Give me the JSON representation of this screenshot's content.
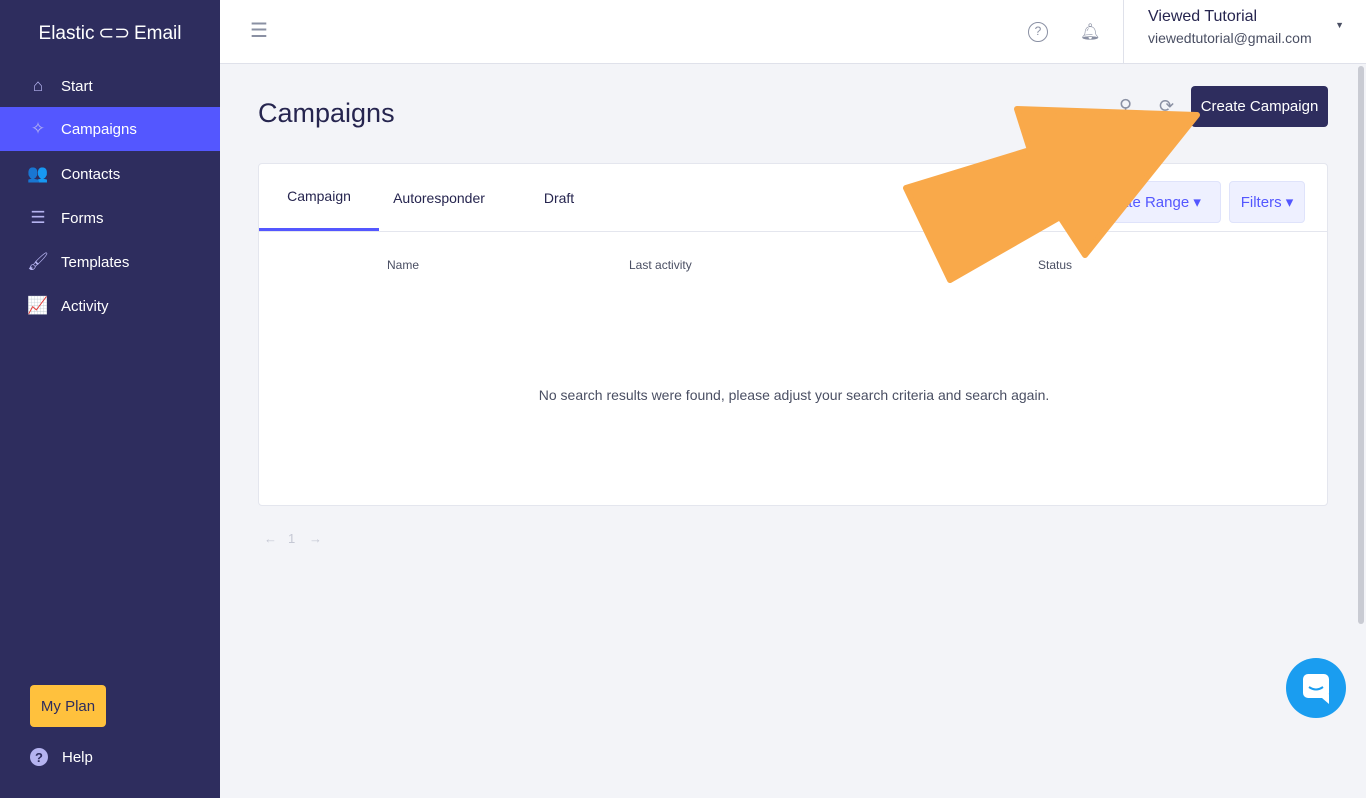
{
  "app": {
    "logo": "Elastic ⊂⊃ Email"
  },
  "sidebar": {
    "items": [
      {
        "label": "Start",
        "icon": "home-icon",
        "glyph": "⌂"
      },
      {
        "label": "Campaigns",
        "icon": "magic-wand-icon",
        "glyph": "✧"
      },
      {
        "label": "Contacts",
        "icon": "users-icon",
        "glyph": "👥"
      },
      {
        "label": "Forms",
        "icon": "list-icon",
        "glyph": "☰"
      },
      {
        "label": "Templates",
        "icon": "brush-icon",
        "glyph": "🖌"
      },
      {
        "label": "Activity",
        "icon": "chart-line-icon",
        "glyph": "📈"
      }
    ],
    "active": "Campaigns",
    "my_plan": "My Plan",
    "help": "Help"
  },
  "header": {
    "user_name": "Viewed Tutorial",
    "user_email": "viewedtutorial@gmail.com"
  },
  "main": {
    "title": "Campaigns",
    "create_button": "Create Campaign",
    "tabs": [
      {
        "label": "Campaign"
      },
      {
        "label": "Autoresponder"
      },
      {
        "label": "Draft"
      }
    ],
    "date_range": "Date Range ▾",
    "filters": "Filters ▾",
    "columns": [
      "Name",
      "Last activity",
      "Status"
    ],
    "empty_message": "No search results were found, please adjust your search criteria and search again.",
    "pager": {
      "prev": "←",
      "page": "1",
      "next": "→"
    }
  },
  "colors": {
    "sidebar": "#2e2d5e",
    "accent": "#5457ff",
    "plan": "#ffc13d",
    "annotation_arrow": "#f9a94a",
    "chat": "#1a9df0"
  }
}
